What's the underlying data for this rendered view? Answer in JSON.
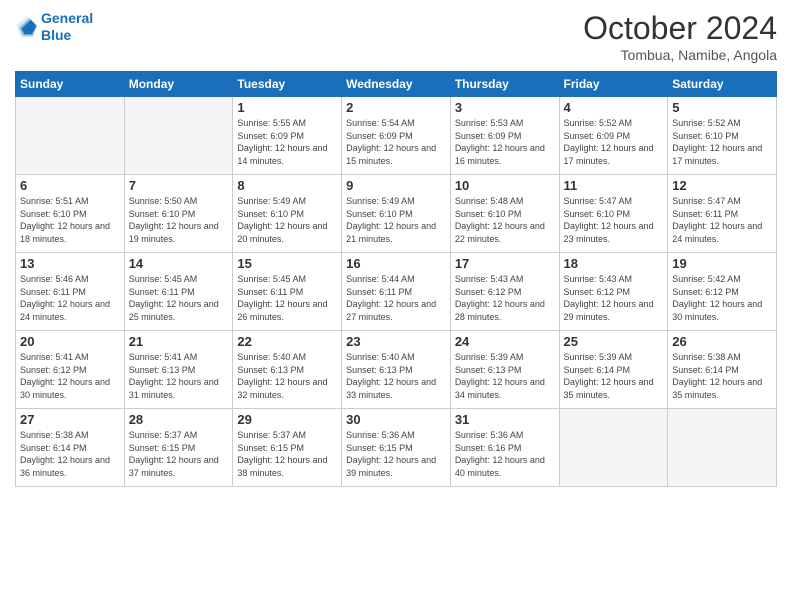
{
  "logo": {
    "line1": "General",
    "line2": "Blue"
  },
  "header": {
    "title": "October 2024",
    "subtitle": "Tombua, Namibe, Angola"
  },
  "weekdays": [
    "Sunday",
    "Monday",
    "Tuesday",
    "Wednesday",
    "Thursday",
    "Friday",
    "Saturday"
  ],
  "weeks": [
    [
      {
        "day": "",
        "sunrise": "",
        "sunset": "",
        "daylight": ""
      },
      {
        "day": "",
        "sunrise": "",
        "sunset": "",
        "daylight": ""
      },
      {
        "day": "1",
        "sunrise": "Sunrise: 5:55 AM",
        "sunset": "Sunset: 6:09 PM",
        "daylight": "Daylight: 12 hours and 14 minutes."
      },
      {
        "day": "2",
        "sunrise": "Sunrise: 5:54 AM",
        "sunset": "Sunset: 6:09 PM",
        "daylight": "Daylight: 12 hours and 15 minutes."
      },
      {
        "day": "3",
        "sunrise": "Sunrise: 5:53 AM",
        "sunset": "Sunset: 6:09 PM",
        "daylight": "Daylight: 12 hours and 16 minutes."
      },
      {
        "day": "4",
        "sunrise": "Sunrise: 5:52 AM",
        "sunset": "Sunset: 6:09 PM",
        "daylight": "Daylight: 12 hours and 17 minutes."
      },
      {
        "day": "5",
        "sunrise": "Sunrise: 5:52 AM",
        "sunset": "Sunset: 6:10 PM",
        "daylight": "Daylight: 12 hours and 17 minutes."
      }
    ],
    [
      {
        "day": "6",
        "sunrise": "Sunrise: 5:51 AM",
        "sunset": "Sunset: 6:10 PM",
        "daylight": "Daylight: 12 hours and 18 minutes."
      },
      {
        "day": "7",
        "sunrise": "Sunrise: 5:50 AM",
        "sunset": "Sunset: 6:10 PM",
        "daylight": "Daylight: 12 hours and 19 minutes."
      },
      {
        "day": "8",
        "sunrise": "Sunrise: 5:49 AM",
        "sunset": "Sunset: 6:10 PM",
        "daylight": "Daylight: 12 hours and 20 minutes."
      },
      {
        "day": "9",
        "sunrise": "Sunrise: 5:49 AM",
        "sunset": "Sunset: 6:10 PM",
        "daylight": "Daylight: 12 hours and 21 minutes."
      },
      {
        "day": "10",
        "sunrise": "Sunrise: 5:48 AM",
        "sunset": "Sunset: 6:10 PM",
        "daylight": "Daylight: 12 hours and 22 minutes."
      },
      {
        "day": "11",
        "sunrise": "Sunrise: 5:47 AM",
        "sunset": "Sunset: 6:10 PM",
        "daylight": "Daylight: 12 hours and 23 minutes."
      },
      {
        "day": "12",
        "sunrise": "Sunrise: 5:47 AM",
        "sunset": "Sunset: 6:11 PM",
        "daylight": "Daylight: 12 hours and 24 minutes."
      }
    ],
    [
      {
        "day": "13",
        "sunrise": "Sunrise: 5:46 AM",
        "sunset": "Sunset: 6:11 PM",
        "daylight": "Daylight: 12 hours and 24 minutes."
      },
      {
        "day": "14",
        "sunrise": "Sunrise: 5:45 AM",
        "sunset": "Sunset: 6:11 PM",
        "daylight": "Daylight: 12 hours and 25 minutes."
      },
      {
        "day": "15",
        "sunrise": "Sunrise: 5:45 AM",
        "sunset": "Sunset: 6:11 PM",
        "daylight": "Daylight: 12 hours and 26 minutes."
      },
      {
        "day": "16",
        "sunrise": "Sunrise: 5:44 AM",
        "sunset": "Sunset: 6:11 PM",
        "daylight": "Daylight: 12 hours and 27 minutes."
      },
      {
        "day": "17",
        "sunrise": "Sunrise: 5:43 AM",
        "sunset": "Sunset: 6:12 PM",
        "daylight": "Daylight: 12 hours and 28 minutes."
      },
      {
        "day": "18",
        "sunrise": "Sunrise: 5:43 AM",
        "sunset": "Sunset: 6:12 PM",
        "daylight": "Daylight: 12 hours and 29 minutes."
      },
      {
        "day": "19",
        "sunrise": "Sunrise: 5:42 AM",
        "sunset": "Sunset: 6:12 PM",
        "daylight": "Daylight: 12 hours and 30 minutes."
      }
    ],
    [
      {
        "day": "20",
        "sunrise": "Sunrise: 5:41 AM",
        "sunset": "Sunset: 6:12 PM",
        "daylight": "Daylight: 12 hours and 30 minutes."
      },
      {
        "day": "21",
        "sunrise": "Sunrise: 5:41 AM",
        "sunset": "Sunset: 6:13 PM",
        "daylight": "Daylight: 12 hours and 31 minutes."
      },
      {
        "day": "22",
        "sunrise": "Sunrise: 5:40 AM",
        "sunset": "Sunset: 6:13 PM",
        "daylight": "Daylight: 12 hours and 32 minutes."
      },
      {
        "day": "23",
        "sunrise": "Sunrise: 5:40 AM",
        "sunset": "Sunset: 6:13 PM",
        "daylight": "Daylight: 12 hours and 33 minutes."
      },
      {
        "day": "24",
        "sunrise": "Sunrise: 5:39 AM",
        "sunset": "Sunset: 6:13 PM",
        "daylight": "Daylight: 12 hours and 34 minutes."
      },
      {
        "day": "25",
        "sunrise": "Sunrise: 5:39 AM",
        "sunset": "Sunset: 6:14 PM",
        "daylight": "Daylight: 12 hours and 35 minutes."
      },
      {
        "day": "26",
        "sunrise": "Sunrise: 5:38 AM",
        "sunset": "Sunset: 6:14 PM",
        "daylight": "Daylight: 12 hours and 35 minutes."
      }
    ],
    [
      {
        "day": "27",
        "sunrise": "Sunrise: 5:38 AM",
        "sunset": "Sunset: 6:14 PM",
        "daylight": "Daylight: 12 hours and 36 minutes."
      },
      {
        "day": "28",
        "sunrise": "Sunrise: 5:37 AM",
        "sunset": "Sunset: 6:15 PM",
        "daylight": "Daylight: 12 hours and 37 minutes."
      },
      {
        "day": "29",
        "sunrise": "Sunrise: 5:37 AM",
        "sunset": "Sunset: 6:15 PM",
        "daylight": "Daylight: 12 hours and 38 minutes."
      },
      {
        "day": "30",
        "sunrise": "Sunrise: 5:36 AM",
        "sunset": "Sunset: 6:15 PM",
        "daylight": "Daylight: 12 hours and 39 minutes."
      },
      {
        "day": "31",
        "sunrise": "Sunrise: 5:36 AM",
        "sunset": "Sunset: 6:16 PM",
        "daylight": "Daylight: 12 hours and 40 minutes."
      },
      {
        "day": "",
        "sunrise": "",
        "sunset": "",
        "daylight": ""
      },
      {
        "day": "",
        "sunrise": "",
        "sunset": "",
        "daylight": ""
      }
    ]
  ]
}
